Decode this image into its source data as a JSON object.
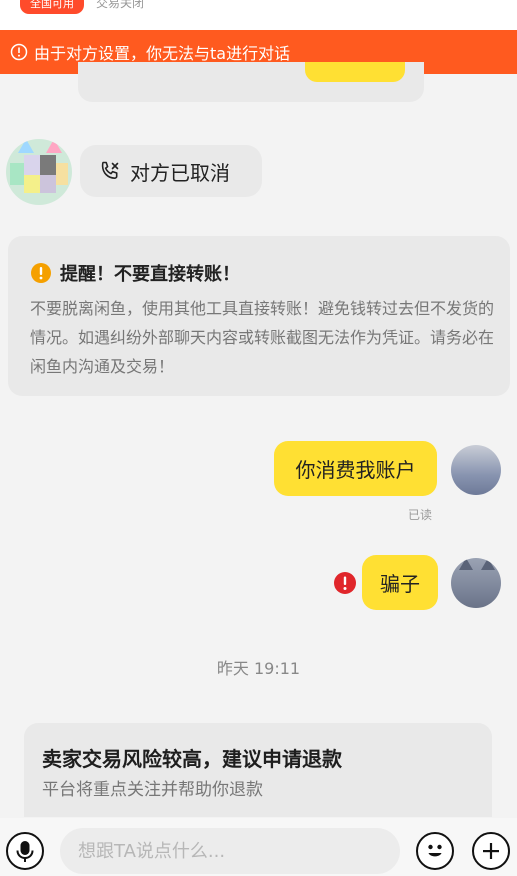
{
  "top_strip": {
    "badge": "全国可用",
    "status": "交易关闭"
  },
  "banner": {
    "text": "由于对方设置，你无法与ta进行对话",
    "color": "#ff5a1f"
  },
  "call_message": {
    "text": "对方已取消",
    "icon": "phone-cancelled-icon"
  },
  "safety_notice": {
    "title": "提醒！不要直接转账！",
    "body": "不要脱离闲鱼，使用其他工具直接转账！避免钱转过去但不发货的情况。如遇纠纷外部聊天内容或转账截图无法作为凭证。请务必在闲鱼内沟通及交易！"
  },
  "messages": [
    {
      "text": "你消费我账户",
      "status": "已读"
    },
    {
      "text": "骗子",
      "error": true
    }
  ],
  "timestamp": "昨天 19:11",
  "refund_card": {
    "title": "卖家交易风险较高，建议申请退款",
    "subtitle": "平台将重点关注并帮助你退款"
  },
  "input": {
    "placeholder": "想跟TA说点什么..."
  },
  "colors": {
    "accent_orange": "#ff5a1f",
    "bubble_yellow": "#ffe033",
    "warning": "#f5a000",
    "error_red": "#e0262b"
  }
}
